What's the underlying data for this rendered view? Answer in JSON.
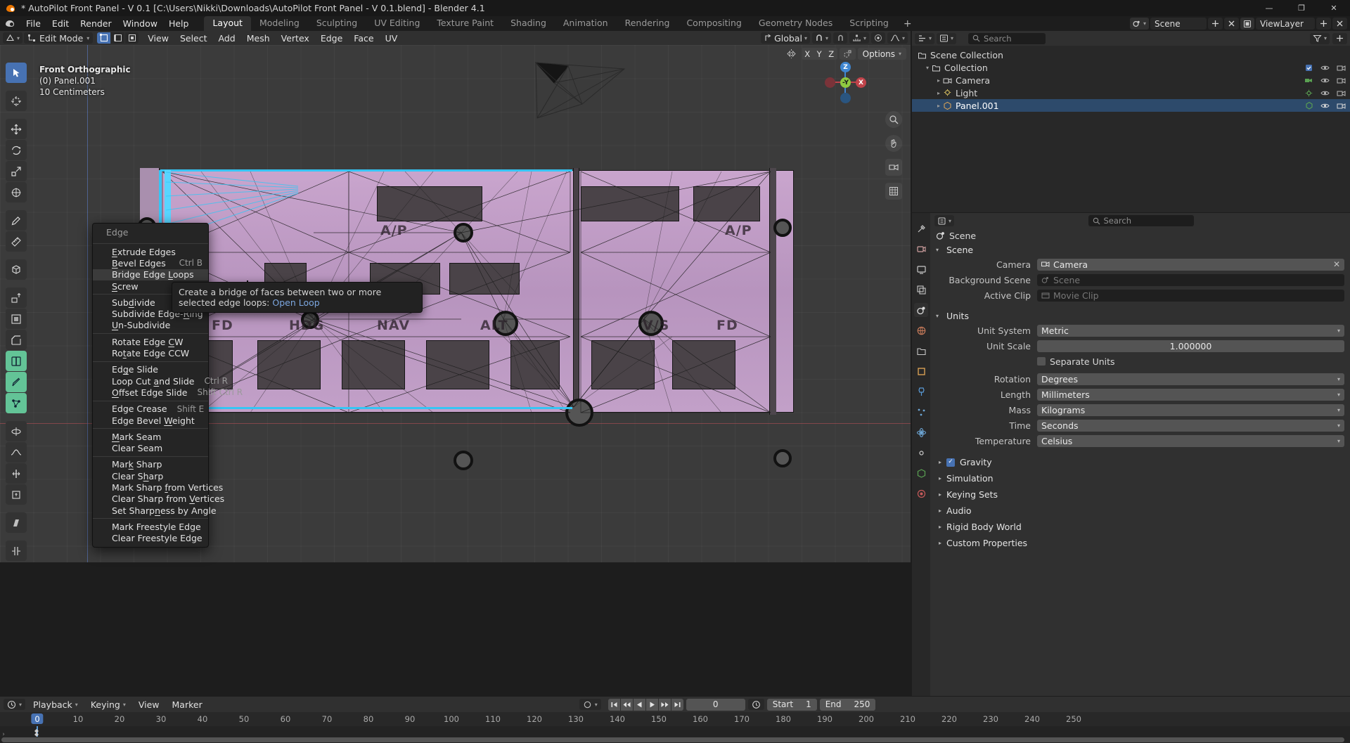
{
  "window": {
    "title": "* AutoPilot Front Panel - V 0.1 [C:\\Users\\Nikki\\Downloads\\AutoPilot Front Panel - V 0.1.blend] - Blender 4.1",
    "minimize": "—",
    "maximize": "❐",
    "close": "✕"
  },
  "topbar": {
    "menus": [
      "File",
      "Edit",
      "Render",
      "Window",
      "Help"
    ],
    "tabs": [
      "Layout",
      "Modeling",
      "Sculpting",
      "UV Editing",
      "Texture Paint",
      "Shading",
      "Animation",
      "Rendering",
      "Compositing",
      "Geometry Nodes",
      "Scripting"
    ],
    "active_tab": "Layout",
    "add_tab": "+",
    "scene_name": "Scene",
    "view_layer_name": "ViewLayer",
    "new_label": "",
    "icons": [
      "blender-logo-icon",
      "scene-icon",
      "view-layer-icon",
      "new-scene-icon",
      "remove-scene-icon"
    ]
  },
  "viewport_header": {
    "editor_type": "editor-type-icon",
    "mode": "Edit Mode",
    "select_modes": [
      "vertex-select-icon",
      "edge-select-icon",
      "face-select-icon"
    ],
    "active_select_mode": "vertex-select-icon",
    "menus": [
      "View",
      "Select",
      "Add",
      "Mesh",
      "Vertex",
      "Edge",
      "Face",
      "UV"
    ],
    "transform_orientation": "Global",
    "snap": "snap-magnet-icon",
    "proportional": "proportional-edit-icon",
    "right_icons": [
      "visibility-icon",
      "gizmo-icon",
      "overlays-icon",
      "xray-icon",
      "shading-wireframe-icon",
      "shading-solid-icon",
      "shading-material-icon",
      "shading-rendered-icon"
    ]
  },
  "viewport": {
    "view_name": "Front Orthographic",
    "collection_line": "(0) Panel.001",
    "grid_scale": "10 Centimeters",
    "mirror_label": "mirror-icon",
    "axes": [
      "X",
      "Y",
      "Z"
    ],
    "options_label": "Options",
    "gizmo_axes": [
      "Z",
      "-Y",
      "X"
    ],
    "toolbar_icons": [
      "tweak-select-box-icon",
      "cursor-icon",
      "move-icon",
      "rotate-icon",
      "scale-icon",
      "transform-icon",
      "annotate-icon",
      "measure-icon",
      "add-cube-icon",
      "extrude-region-icon",
      "inset-faces-icon",
      "bevel-icon",
      "loop-cut-icon",
      "knife-icon",
      "poly-build-icon",
      "spin-icon",
      "smooth-icon",
      "edge-slide-icon",
      "shrink-fatten-icon",
      "shear-icon",
      "rip-region-icon"
    ],
    "nav_icons": [
      "zoom-icon",
      "pan-hand-icon",
      "camera-view-icon",
      "toggle-ortho-icon"
    ],
    "panel_text_labels": [
      "A/P",
      "A/P",
      "HDG",
      "NAV",
      "ALT",
      "V/S",
      "FD",
      "FD"
    ]
  },
  "edge_menu": {
    "title": "Edge",
    "groups": [
      [
        {
          "label": "Extrude Edges",
          "accel": "E",
          "shortcut": ""
        },
        {
          "label": "Bevel Edges",
          "accel": "B",
          "shortcut": "Ctrl B"
        },
        {
          "label": "Bridge Edge Loops",
          "accel": "L",
          "shortcut": "",
          "highlighted": true
        },
        {
          "label": "Screw",
          "accel": "S",
          "shortcut": ""
        }
      ],
      [
        {
          "label": "Subdivide",
          "accel": "d",
          "shortcut": ""
        },
        {
          "label": "Subdivide Edge-Ring",
          "accel": "R",
          "shortcut": ""
        },
        {
          "label": "Un-Subdivide",
          "accel": "U",
          "shortcut": ""
        }
      ],
      [
        {
          "label": "Rotate Edge CW",
          "accel": "C",
          "shortcut": ""
        },
        {
          "label": "Rotate Edge CCW",
          "accel": "t",
          "shortcut": ""
        }
      ],
      [
        {
          "label": "Edge Slide",
          "accel": "g",
          "shortcut": ""
        },
        {
          "label": "Loop Cut and Slide",
          "accel": "a",
          "shortcut": "Ctrl R"
        },
        {
          "label": "Offset Edge Slide",
          "accel": "O",
          "shortcut": "Shift Ctrl R"
        }
      ],
      [
        {
          "label": "Edge Crease",
          "accel": "",
          "shortcut": "Shift E"
        },
        {
          "label": "Edge Bevel Weight",
          "accel": "W",
          "shortcut": ""
        }
      ],
      [
        {
          "label": "Mark Seam",
          "accel": "M",
          "shortcut": ""
        },
        {
          "label": "Clear Seam",
          "accel": "",
          "shortcut": ""
        }
      ],
      [
        {
          "label": "Mark Sharp",
          "accel": "k",
          "shortcut": ""
        },
        {
          "label": "Clear Sharp",
          "accel": "h",
          "shortcut": ""
        },
        {
          "label": "Mark Sharp from Vertices",
          "accel": "f",
          "shortcut": ""
        },
        {
          "label": "Clear Sharp from Vertices",
          "accel": "V",
          "shortcut": ""
        },
        {
          "label": "Set Sharpness by Angle",
          "accel": "n",
          "shortcut": ""
        }
      ],
      [
        {
          "label": "Mark Freestyle Edge",
          "accel": "",
          "shortcut": ""
        },
        {
          "label": "Clear Freestyle Edge",
          "accel": "",
          "shortcut": ""
        }
      ]
    ]
  },
  "tooltip": {
    "text": "Create a bridge of faces between two or more selected edge loops:",
    "link": "Open Loop"
  },
  "outliner": {
    "display_mode_icon": "outliner-display-mode-icon",
    "filter_icon": "filter-icon",
    "search_placeholder": "Search",
    "rows": [
      {
        "label": "Scene Collection",
        "indent": 0,
        "icon": "collection-icon",
        "expanded": true,
        "selected": false,
        "has_tri": false
      },
      {
        "label": "Collection",
        "indent": 1,
        "icon": "collection-icon",
        "expanded": true,
        "selected": false,
        "has_tri": true
      },
      {
        "label": "Camera",
        "indent": 2,
        "icon": "camera-data-icon",
        "expanded": false,
        "selected": false,
        "has_tri": true
      },
      {
        "label": "Light",
        "indent": 2,
        "icon": "light-data-icon",
        "expanded": false,
        "selected": false,
        "has_tri": true
      },
      {
        "label": "Panel.001",
        "indent": 2,
        "icon": "mesh-data-icon",
        "expanded": false,
        "selected": true,
        "has_tri": true
      }
    ]
  },
  "properties": {
    "search_placeholder": "Search",
    "breadcrumb": "Scene",
    "tabs": [
      "tool-icon",
      "render-icon",
      "output-icon",
      "view-layer-icon",
      "scene-icon",
      "world-icon",
      "collection-icon",
      "object-icon",
      "modifier-icon",
      "particles-icon",
      "physics-icon",
      "constraints-icon",
      "object-data-icon",
      "material-icon"
    ],
    "active_tab_index": 4,
    "panels": [
      {
        "name": "Scene",
        "expanded": true,
        "rows": [
          {
            "label": "Camera",
            "value": "Camera",
            "type": "id",
            "icon": "camera-icon",
            "clearable": true
          },
          {
            "label": "Background Scene",
            "value": "Scene",
            "type": "id-empty",
            "icon": "scene-icon"
          },
          {
            "label": "Active Clip",
            "value": "Movie Clip",
            "type": "id-empty",
            "icon": "clip-icon"
          }
        ]
      },
      {
        "name": "Units",
        "expanded": true,
        "rows": [
          {
            "label": "Unit System",
            "value": "Metric",
            "type": "dropdown"
          },
          {
            "label": "Unit Scale",
            "value": "1.000000",
            "type": "number"
          },
          {
            "label": "",
            "value": "Separate Units",
            "type": "checkbox",
            "checked": false
          },
          {
            "label": "Rotation",
            "value": "Degrees",
            "type": "dropdown"
          },
          {
            "label": "Length",
            "value": "Millimeters",
            "type": "dropdown"
          },
          {
            "label": "Mass",
            "value": "Kilograms",
            "type": "dropdown"
          },
          {
            "label": "Time",
            "value": "Seconds",
            "type": "dropdown"
          },
          {
            "label": "Temperature",
            "value": "Celsius",
            "type": "dropdown"
          }
        ]
      }
    ],
    "collapsed_panels": [
      {
        "name": "Gravity",
        "checkbox": true,
        "checked": true
      },
      {
        "name": "Simulation",
        "checkbox": false
      },
      {
        "name": "Keying Sets",
        "checkbox": false
      },
      {
        "name": "Audio",
        "checkbox": false
      },
      {
        "name": "Rigid Body World",
        "checkbox": false
      },
      {
        "name": "Custom Properties",
        "checkbox": false
      }
    ]
  },
  "timeline": {
    "editor_icon": "timeline-editor-icon",
    "menus": [
      "Playback",
      "Keying",
      "View",
      "Marker"
    ],
    "auto_key_icon": "record-icon",
    "transport": [
      "jump-to-start-icon",
      "jump-to-keyframe-prev-icon",
      "play-reverse-icon",
      "play-icon",
      "jump-to-keyframe-next-icon",
      "jump-to-end-icon"
    ],
    "current_frame": "0",
    "start_label": "Start",
    "start_value": "1",
    "end_label": "End",
    "end_value": "250",
    "ticks": [
      "0",
      "10",
      "20",
      "30",
      "40",
      "50",
      "60",
      "70",
      "80",
      "90",
      "100",
      "110",
      "120",
      "130",
      "140",
      "150",
      "160",
      "170",
      "180",
      "190",
      "200",
      "210",
      "220",
      "230",
      "240",
      "250"
    ],
    "playhead_frame": "0"
  },
  "colors": {
    "accent_blue": "#4772b3",
    "selection_cyan": "#36c5f4",
    "mesh_purple": "#b794be",
    "bg_dark": "#1d1d1d",
    "bg_panel": "#303030",
    "outliner_sel": "#2d4a6b",
    "tooltip_link": "#7ca7e0",
    "axis_x_red": "#bb5060",
    "axis_z_blue": "#5a78be"
  }
}
